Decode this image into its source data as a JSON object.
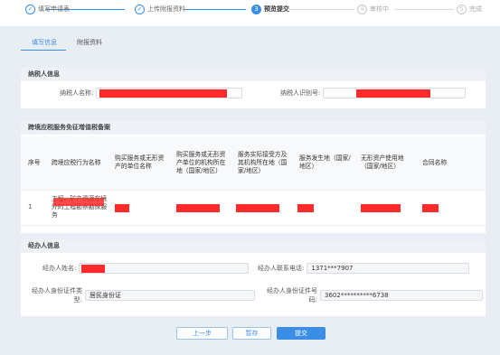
{
  "steps": [
    {
      "num": "✓",
      "label": "填写申请表",
      "state": "done"
    },
    {
      "num": "✓",
      "label": "上传附报资料",
      "state": "done"
    },
    {
      "num": "3",
      "label": "预览提交",
      "state": "active"
    },
    {
      "num": "4",
      "label": "审核中",
      "state": "todo"
    },
    {
      "num": "5",
      "label": "完成",
      "state": "todo"
    }
  ],
  "tabs": [
    {
      "label": "填写信息",
      "active": true
    },
    {
      "label": "附报资料",
      "active": false
    }
  ],
  "taxpayer": {
    "title": "纳税人信息",
    "name_label": "纳税人名称:",
    "id_label": "纳税人识别号:"
  },
  "filing": {
    "title": "跨境应税服务免征增值税备案",
    "columns": [
      "序号",
      "跨境应税行为名称",
      "购买服务或无形资产的单位名称",
      "购买服务或无形资产单位的机构所在地（国家/地区）",
      "服务实际接受方及其机构所在地（国家/地区）",
      "服务发生地（国家/地区）",
      "无形资产使用地（国家/地区）",
      "合同名称"
    ],
    "rows": [
      {
        "index": "1",
        "service_name": "工程、矿产资源在境外的工程勘察勘探服务"
      }
    ]
  },
  "agent": {
    "title": "经办人信息",
    "name_label": "经办人姓名:",
    "phone_label": "经办人联系电话:",
    "phone_value": "1371***7907",
    "idtype_label": "经办人身份证件类型:",
    "idtype_value": "居民身份证",
    "idno_label": "经办人身份证件号码:",
    "idno_value": "3602**********6738"
  },
  "buttons": {
    "prev": "上一步",
    "save": "暂存",
    "submit": "提交"
  },
  "colors": {
    "accent": "#3a8ee6",
    "redaction": "#ff2a2a"
  }
}
